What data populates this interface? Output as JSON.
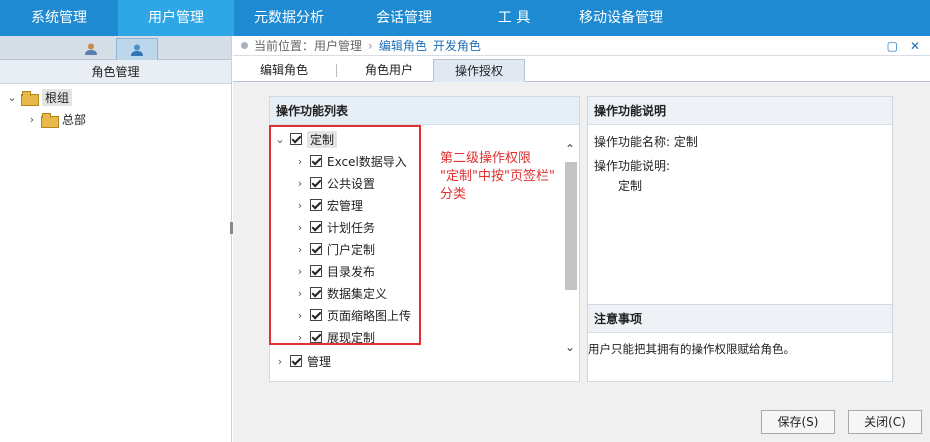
{
  "topnav": [
    "系统管理",
    "用户管理",
    "元数据分析",
    "会话管理",
    "工 具",
    "移动设备管理"
  ],
  "sidebar": {
    "title": "角色管理",
    "tree": [
      {
        "label": "根组",
        "expanded": true
      },
      {
        "label": "总部",
        "expanded": false
      }
    ]
  },
  "breadcrumb": {
    "prefix": "当前位置：",
    "items": [
      "用户管理",
      "编辑角色",
      "开发角色"
    ]
  },
  "tabs": [
    "编辑角色",
    "角色用户",
    "操作授权"
  ],
  "func_list": {
    "title": "操作功能列表",
    "root": "定制",
    "children": [
      "Excel数据导入",
      "公共设置",
      "宏管理",
      "计划任务",
      "门户定制",
      "目录发布",
      "数据集定义",
      "页面缩略图上传",
      "展现定制"
    ],
    "sibling": "管理"
  },
  "annotation": [
    "第二级操作权限",
    "\"定制\"中按\"页签栏\"",
    "分类"
  ],
  "desc": {
    "title": "操作功能说明",
    "name_line": "操作功能名称: 定制",
    "desc_label": "操作功能说明:",
    "desc_value": "定制"
  },
  "notice": {
    "title": "注意事项",
    "text": "用户只能把其拥有的操作权限赋给角色。"
  },
  "buttons": {
    "save": "保存(S)",
    "close": "关闭(C)"
  },
  "colors": {
    "nav": "#1d8ad2",
    "nav_active": "#2fa6e6",
    "annotation": "#e03030"
  }
}
